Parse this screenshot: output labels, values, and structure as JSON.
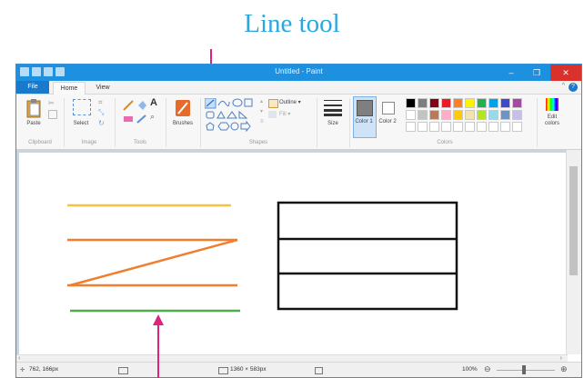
{
  "callout": {
    "label": "Line tool"
  },
  "window": {
    "title": "Untitled - Paint",
    "minimize_glyph": "–",
    "maximize_glyph": "❐",
    "close_glyph": "✕",
    "help_glyph": "?"
  },
  "tabs": {
    "file": "File",
    "home": "Home",
    "view": "View"
  },
  "ribbon": {
    "groups": {
      "clipboard": "Clipboard",
      "image": "Image",
      "tools": "Tools",
      "shapes": "Shapes",
      "colors": "Colors"
    },
    "paste": "Paste",
    "select": "Select",
    "brushes": "Brushes",
    "outline": "Outline ▾",
    "fill": "Fill ▾",
    "size": "Size",
    "color1": "Color 1",
    "color2": "Color 2",
    "edit_colors": "Edit colors",
    "palette_row1": [
      "#000000",
      "#7f7f7f",
      "#880015",
      "#ed1c24",
      "#ff7f27",
      "#fff200",
      "#22b14c",
      "#00a2e8",
      "#3f48cc",
      "#a349a4"
    ],
    "palette_row2": [
      "#ffffff",
      "#c3c3c3",
      "#b97a57",
      "#ffaec9",
      "#ffc90e",
      "#efe4b0",
      "#b5e61d",
      "#99d9ea",
      "#7092be",
      "#c8bfe7"
    ]
  },
  "drawing": {
    "colors": {
      "yellow": "#f5c342",
      "orange": "#f07e2e",
      "green": "#4cae4f",
      "black": "#111111"
    }
  },
  "status": {
    "cursor": "762, 166px",
    "size": "1360 × 583px",
    "zoom": "100%"
  },
  "colors": {
    "title_bar": "#1e90e0",
    "file_tab": "#1979ca",
    "callout": "#29a7de",
    "arrow": "#e0237a"
  }
}
